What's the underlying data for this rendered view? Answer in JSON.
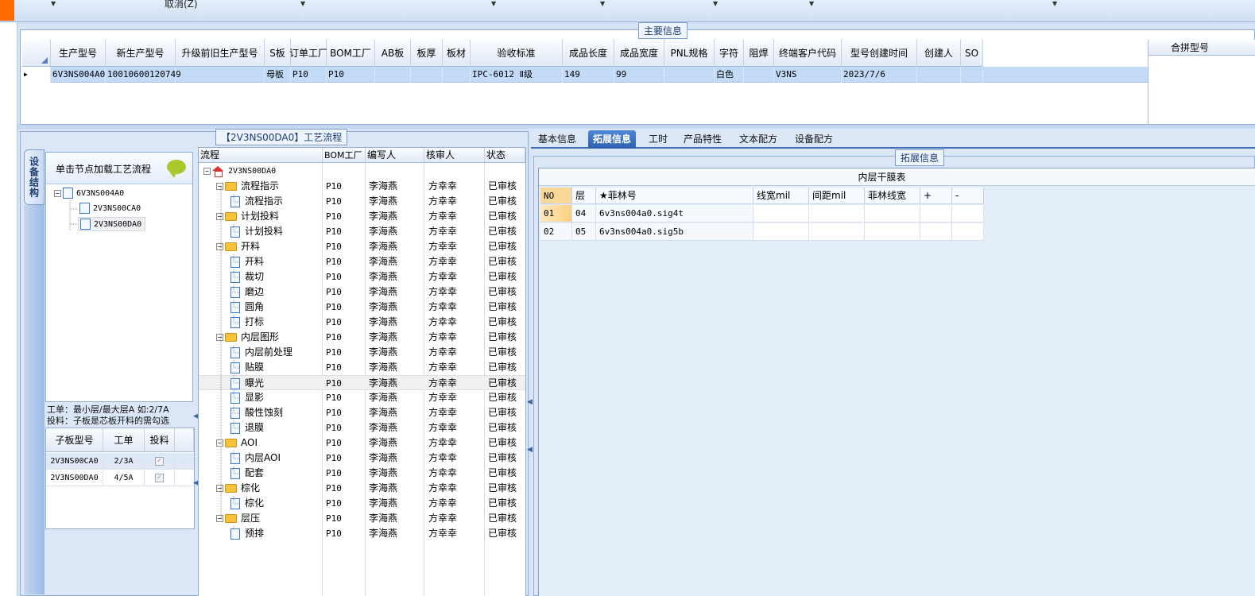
{
  "toolbar": {
    "cancel_label": "取消(Z)"
  },
  "main_info": {
    "title": "主要信息",
    "columns": [
      "生产型号",
      "新生产型号",
      "升级前旧生产型号",
      "S板",
      "订单工厂",
      "BOM工厂",
      "AB板",
      "板厚",
      "板材",
      "验收标准",
      "成品长度",
      "成品宽度",
      "PNL规格",
      "字符",
      "阻焊",
      "终端客户代码",
      "型号创建时间",
      "创建人",
      "SO"
    ],
    "row": [
      "6V3NS004A0",
      "10010600120749",
      "",
      "母板",
      "P10",
      "P10",
      "",
      "",
      "",
      "IPC-6012 Ⅱ级",
      "149",
      "99",
      "",
      "白色",
      "",
      "V3NS",
      "2023/7/6",
      "",
      ""
    ],
    "merge_header": "合拼型号"
  },
  "flow_group": {
    "title": "【2V3NS00DA0】工艺流程",
    "side_tab": "设备结构",
    "tree_hint": "单击节点加载工艺流程",
    "tree": {
      "root": "6V3NS004A0",
      "children": [
        "2V3NS00CA0",
        "2V3NS00DA0"
      ]
    },
    "note_line1": "工单：最小层/最大层A 如:2/7A",
    "note_line2": "投料：子板是芯板开料的需勾选",
    "sub_table": {
      "headers": [
        "子板型号",
        "工单",
        "投料"
      ],
      "rows": [
        {
          "model": "2V3NS00CA0",
          "order": "2/3A",
          "check": "✓"
        },
        {
          "model": "2V3NS00DA0",
          "order": "4/5A",
          "check": "✓"
        }
      ]
    },
    "flow_table": {
      "headers": [
        "流程",
        "BOM工厂",
        "编写人",
        "核审人",
        "状态"
      ],
      "root": "2V3NS00DA0",
      "rows": [
        {
          "name": "流程指示",
          "level": 1,
          "bom": "P10",
          "writer": "李海燕",
          "reviewer": "方幸幸",
          "status": "已审核"
        },
        {
          "name": "流程指示",
          "level": 2,
          "bom": "P10",
          "writer": "李海燕",
          "reviewer": "方幸幸",
          "status": "已审核"
        },
        {
          "name": "计划投料",
          "level": 1,
          "bom": "P10",
          "writer": "李海燕",
          "reviewer": "方幸幸",
          "status": "已审核"
        },
        {
          "name": "计划投料",
          "level": 2,
          "bom": "P10",
          "writer": "李海燕",
          "reviewer": "方幸幸",
          "status": "已审核"
        },
        {
          "name": "开料",
          "level": 1,
          "bom": "P10",
          "writer": "李海燕",
          "reviewer": "方幸幸",
          "status": "已审核"
        },
        {
          "name": "开料",
          "level": 2,
          "bom": "P10",
          "writer": "李海燕",
          "reviewer": "方幸幸",
          "status": "已审核"
        },
        {
          "name": "裁切",
          "level": 2,
          "bom": "P10",
          "writer": "李海燕",
          "reviewer": "方幸幸",
          "status": "已审核"
        },
        {
          "name": "磨边",
          "level": 2,
          "bom": "P10",
          "writer": "李海燕",
          "reviewer": "方幸幸",
          "status": "已审核"
        },
        {
          "name": "圆角",
          "level": 2,
          "bom": "P10",
          "writer": "李海燕",
          "reviewer": "方幸幸",
          "status": "已审核"
        },
        {
          "name": "打标",
          "level": 2,
          "bom": "P10",
          "writer": "李海燕",
          "reviewer": "方幸幸",
          "status": "已审核"
        },
        {
          "name": "内层图形",
          "level": 1,
          "bom": "P10",
          "writer": "李海燕",
          "reviewer": "方幸幸",
          "status": "已审核"
        },
        {
          "name": "内层前处理",
          "level": 2,
          "bom": "P10",
          "writer": "李海燕",
          "reviewer": "方幸幸",
          "status": "已审核"
        },
        {
          "name": "贴膜",
          "level": 2,
          "bom": "P10",
          "writer": "李海燕",
          "reviewer": "方幸幸",
          "status": "已审核"
        },
        {
          "name": "曝光",
          "level": 2,
          "bom": "P10",
          "writer": "李海燕",
          "reviewer": "方幸幸",
          "status": "已审核",
          "selected": true
        },
        {
          "name": "显影",
          "level": 2,
          "bom": "P10",
          "writer": "李海燕",
          "reviewer": "方幸幸",
          "status": "已审核"
        },
        {
          "name": "酸性蚀刻",
          "level": 2,
          "bom": "P10",
          "writer": "李海燕",
          "reviewer": "方幸幸",
          "status": "已审核"
        },
        {
          "name": "退膜",
          "level": 2,
          "bom": "P10",
          "writer": "李海燕",
          "reviewer": "方幸幸",
          "status": "已审核"
        },
        {
          "name": "AOI",
          "level": 1,
          "bom": "P10",
          "writer": "李海燕",
          "reviewer": "方幸幸",
          "status": "已审核"
        },
        {
          "name": "内层AOI",
          "level": 2,
          "bom": "P10",
          "writer": "李海燕",
          "reviewer": "方幸幸",
          "status": "已审核"
        },
        {
          "name": "配套",
          "level": 2,
          "bom": "P10",
          "writer": "李海燕",
          "reviewer": "方幸幸",
          "status": "已审核"
        },
        {
          "name": "棕化",
          "level": 1,
          "bom": "P10",
          "writer": "李海燕",
          "reviewer": "方幸幸",
          "status": "已审核"
        },
        {
          "name": "棕化",
          "level": 2,
          "bom": "P10",
          "writer": "李海燕",
          "reviewer": "方幸幸",
          "status": "已审核"
        },
        {
          "name": "层压",
          "level": 1,
          "bom": "P10",
          "writer": "李海燕",
          "reviewer": "方幸幸",
          "status": "已审核"
        },
        {
          "name": "预排",
          "level": 2,
          "bom": "P10",
          "writer": "李海燕",
          "reviewer": "方幸幸",
          "status": "已审核"
        }
      ]
    }
  },
  "right_panel": {
    "tabs": [
      "基本信息",
      "拓展信息",
      "工时",
      "产品特性",
      "文本配方",
      "设备配方"
    ],
    "active_tab": "拓展信息",
    "ext_title": "拓展信息",
    "film_table": {
      "title": "内层干膜表",
      "headers": [
        "NO",
        "层",
        "★菲林号",
        "线宽mil",
        "间距mil",
        "菲林线宽",
        "+",
        "-"
      ],
      "rows": [
        [
          "01",
          "04",
          "6v3ns004a0.sig4t",
          "",
          "",
          "",
          "",
          ""
        ],
        [
          "02",
          "05",
          "6v3ns004a0.sig5b",
          "",
          "",
          "",
          "",
          ""
        ]
      ]
    }
  }
}
